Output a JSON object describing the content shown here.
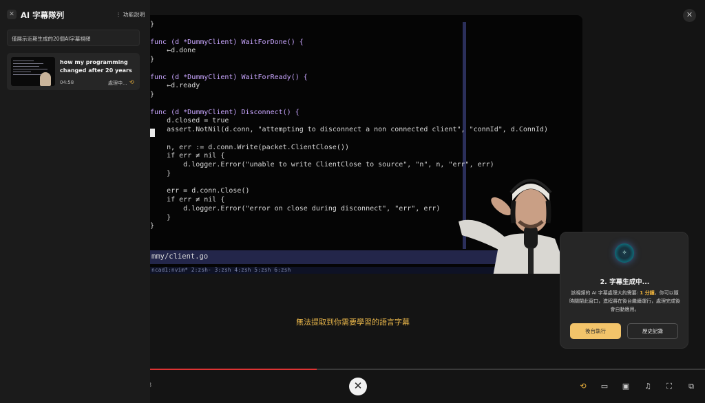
{
  "sidebar": {
    "title": "AI 字幕隊列",
    "help_label": "功能說明",
    "notice": "僅展示近期生成的20個AI字幕視頻",
    "queue": [
      {
        "title": "how my programming changed after 20 years",
        "duration": "04:58",
        "status": "處理中..."
      }
    ]
  },
  "video": {
    "code_lines": [
      "}",
      "",
      "func (d *DummyClient) WaitForDone() {",
      "    ←d.done",
      "}",
      "",
      "func (d *DummyClient) WaitForReady() {",
      "    ←d.ready",
      "}",
      "",
      "func (d *DummyClient) Disconnect() {",
      "    d.closed = true",
      "    assert.NotNil(d.conn, \"attempting to disconnect a non connected client\", \"connId\", d.ConnId)",
      "",
      "    n, err := d.conn.Write(packet.ClientClose())",
      "    if err ≠ nil {",
      "        d.logger.Error(\"unable to write ClientClose to source\", \"n\", n, \"err\", err)",
      "    }",
      "",
      "    err = d.conn.Close()",
      "    if err ≠ nil {",
      "        d.logger.Error(\"error on close during disconnect\", \"err\", err)",
      "    }",
      "}"
    ],
    "status_file": "mmy/client.go",
    "tmux_line": "ncad1:nvim* 2:zsh- 3:zsh  4:zsh  5:zsh  6:zsh",
    "subtitle_message": "無法提取到你需要學習的語言字幕",
    "progress": 0.3
  },
  "generation_panel": {
    "title": "2. 字幕生成中...",
    "desc_before": "該視頻的 AI 字幕處理大約需要: ",
    "desc_highlight": "1 分鐘",
    "desc_after": "，你可以隨時關閉此窗口，進程將在後台繼續運行，處理完成後會自動應用。",
    "background_button": "後台執行",
    "history_button": "歷史記錄"
  },
  "colors": {
    "accent": "#f0b43c",
    "progress": "#dd3333"
  },
  "icons": {
    "close": "✕",
    "menu": "⋮",
    "sparkle": "✧",
    "subtitle_ai": "⟲",
    "captions": "▭",
    "miniplayer": "▣",
    "headphones": "♫",
    "fullscreen": "⛶",
    "cast": "⧉"
  }
}
